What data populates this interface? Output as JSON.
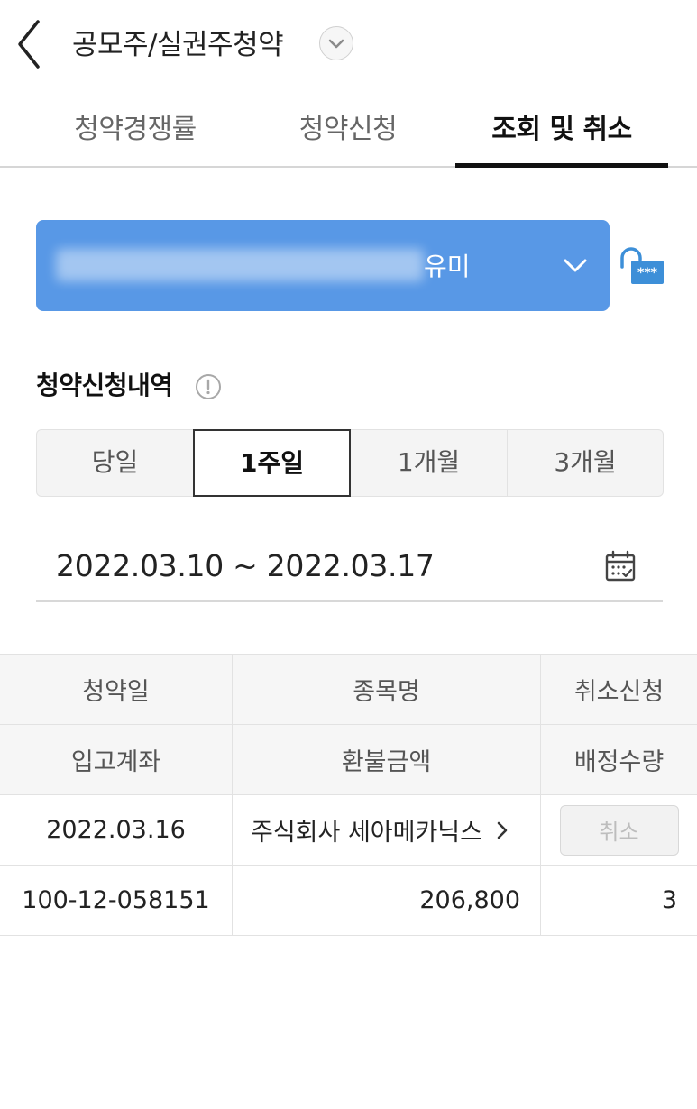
{
  "header": {
    "title": "공모주/실권주청약",
    "icons": {
      "back": "back-chevron-icon",
      "dropdown": "chevron-down-circle-icon"
    }
  },
  "tabs": [
    {
      "label": "청약경쟁률",
      "active": false
    },
    {
      "label": "청약신청",
      "active": false
    },
    {
      "label": "조회 및 취소",
      "active": true
    }
  ],
  "account": {
    "name_visible": "유미",
    "number_masked": "(blurred)",
    "color": "#5898e6",
    "icons": {
      "dropdown": "chevron-down-icon",
      "password": "unlock-password-icon"
    }
  },
  "section": {
    "title": "청약신청내역",
    "info_icon": "info-circle-icon"
  },
  "period": {
    "options": [
      "당일",
      "1주일",
      "1개월",
      "3개월"
    ],
    "selected": "1주일"
  },
  "date_range": {
    "text": "2022.03.10 ~ 2022.03.17",
    "icon": "calendar-icon"
  },
  "table": {
    "header_row1": [
      "청약일",
      "종목명",
      "취소신청"
    ],
    "header_row2": [
      "입고계좌",
      "환불금액",
      "배정수량"
    ],
    "rows": [
      {
        "date": "2022.03.16",
        "stock": "주식회사 세아메카닉스",
        "cancel_label": "취소",
        "account": "100-12-058151",
        "refund": "206,800",
        "allotted": "3"
      }
    ]
  }
}
